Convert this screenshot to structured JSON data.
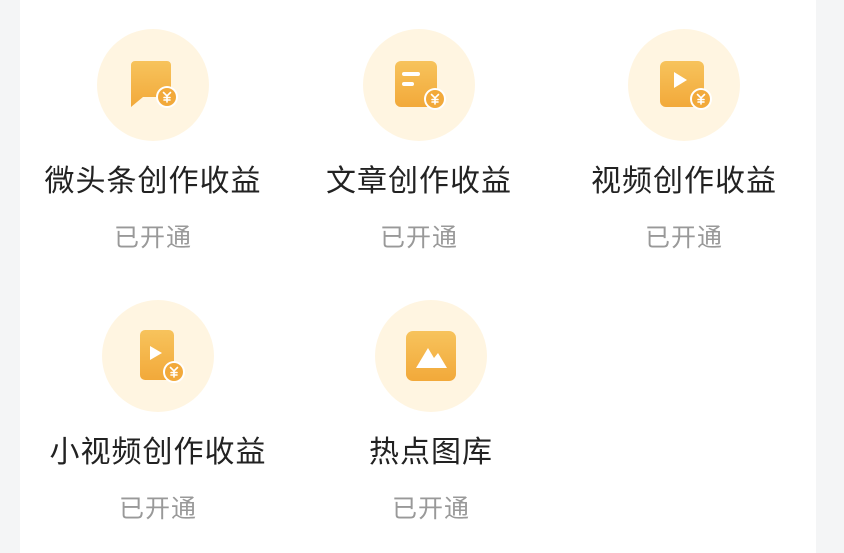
{
  "accent_color": "#f5b83f",
  "icon_bg_color": "#fff5e1",
  "items": [
    {
      "title": "微头条创作收益",
      "status": "已开通",
      "icon": "chat-bubble-yuan-icon"
    },
    {
      "title": "文章创作收益",
      "status": "已开通",
      "icon": "article-yuan-icon"
    },
    {
      "title": "视频创作收益",
      "status": "已开通",
      "icon": "video-yuan-icon"
    },
    {
      "title": "小视频创作收益",
      "status": "已开通",
      "icon": "short-video-yuan-icon"
    },
    {
      "title": "热点图库",
      "status": "已开通",
      "icon": "image-gallery-icon"
    }
  ]
}
